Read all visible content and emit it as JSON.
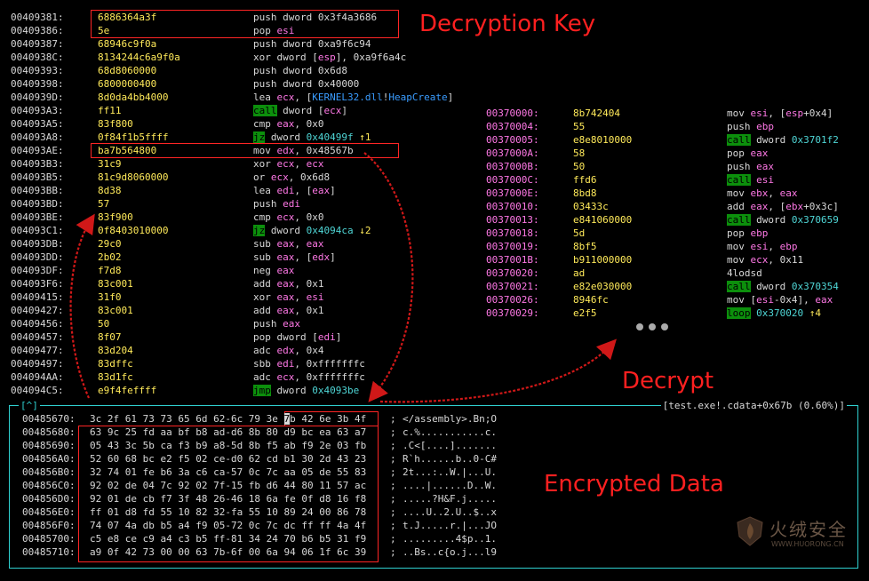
{
  "callouts": {
    "key": "Decryption Key",
    "decrypt": "Decrypt",
    "encrypted": "Encrypted Data"
  },
  "left_disasm": [
    {
      "addr": "00409381:",
      "bytes": "6886364a3f",
      "ins": "push dword 0x3f4a3686"
    },
    {
      "addr": "00409386:",
      "bytes": "5e",
      "ins": "pop esi"
    },
    {
      "addr": "00409387:",
      "bytes": "68946c9f0a",
      "ins": "push dword 0xa9f6c94"
    },
    {
      "addr": "0040938C:",
      "bytes": "8134244c6a9f0a",
      "ins": "xor dword [esp], 0xa9f6a4c"
    },
    {
      "addr": "00409393:",
      "bytes": "68d8060000",
      "ins": "push dword 0x6d8"
    },
    {
      "addr": "00409398:",
      "bytes": "6800000400",
      "ins": "push dword 0x40000"
    },
    {
      "addr": "0040939D:",
      "bytes": "8d0da4bb4000",
      "ins": "lea ecx, [KERNEL32.dll!HeapCreate]"
    },
    {
      "addr": "004093A3:",
      "bytes": "ff11",
      "ins": "call dword [ecx]"
    },
    {
      "addr": "004093A5:",
      "bytes": "83f800",
      "ins": "cmp eax, 0x0"
    },
    {
      "addr": "004093A8:",
      "bytes": "0f84f1b5ffff",
      "ins": "jz dword 0x40499f ↑1"
    },
    {
      "addr": "004093AE:",
      "bytes": "ba7b564800",
      "ins": "mov edx, 0x48567b"
    },
    {
      "addr": "004093B3:",
      "bytes": "31c9",
      "ins": "xor ecx, ecx"
    },
    {
      "addr": "004093B5:",
      "bytes": "81c9d8060000",
      "ins": "or ecx, 0x6d8"
    },
    {
      "addr": "004093BB:",
      "bytes": "8d38",
      "ins": "lea edi, [eax]"
    },
    {
      "addr": "004093BD:",
      "bytes": "57",
      "ins": "push edi"
    },
    {
      "addr": "004093BE:",
      "bytes": "83f900",
      "ins": "cmp ecx, 0x0"
    },
    {
      "addr": "004093C1:",
      "bytes": "0f8403010000",
      "ins": "jz dword 0x4094ca ↓2"
    },
    {
      "addr": "004093DB:",
      "bytes": "29c0",
      "ins": "sub eax, eax"
    },
    {
      "addr": "004093DD:",
      "bytes": "2b02",
      "ins": "sub eax, [edx]"
    },
    {
      "addr": "004093DF:",
      "bytes": "f7d8",
      "ins": "neg eax"
    },
    {
      "addr": "004093F6:",
      "bytes": "83c001",
      "ins": "add eax, 0x1"
    },
    {
      "addr": "00409415:",
      "bytes": "31f0",
      "ins": "xor eax, esi"
    },
    {
      "addr": "00409427:",
      "bytes": "83c001",
      "ins": "add eax, 0x1"
    },
    {
      "addr": "00409456:",
      "bytes": "50",
      "ins": "push eax"
    },
    {
      "addr": "00409457:",
      "bytes": "8f07",
      "ins": "pop dword [edi]"
    },
    {
      "addr": "00409477:",
      "bytes": "83d204",
      "ins": "adc edx, 0x4"
    },
    {
      "addr": "00409497:",
      "bytes": "83dffc",
      "ins": "sbb edi, 0xfffffffc"
    },
    {
      "addr": "004094AA:",
      "bytes": "83d1fc",
      "ins": "adc ecx, 0xfffffffc"
    },
    {
      "addr": "004094C5:",
      "bytes": "e9f4feffff",
      "ins": "jmp dword 0x4093be"
    }
  ],
  "right_disasm": [
    {
      "addr": "00370000:",
      "bytes": "8b742404",
      "ins": "mov esi, [esp+0x4]"
    },
    {
      "addr": "00370004:",
      "bytes": "55",
      "ins": "push ebp"
    },
    {
      "addr": "00370005:",
      "bytes": "e8e8010000",
      "ins": "call dword 0x3701f2"
    },
    {
      "addr": "0037000A:",
      "bytes": "58",
      "ins": "pop eax"
    },
    {
      "addr": "0037000B:",
      "bytes": "50",
      "ins": "push eax"
    },
    {
      "addr": "0037000C:",
      "bytes": "ffd6",
      "ins": "call esi"
    },
    {
      "addr": "0037000E:",
      "bytes": "8bd8",
      "ins": "mov ebx, eax"
    },
    {
      "addr": "00370010:",
      "bytes": "03433c",
      "ins": "add eax, [ebx+0x3c]"
    },
    {
      "addr": "00370013:",
      "bytes": "e841060000",
      "ins": "call dword 0x370659"
    },
    {
      "addr": "00370018:",
      "bytes": "5d",
      "ins": "pop ebp"
    },
    {
      "addr": "00370019:",
      "bytes": "8bf5",
      "ins": "mov esi, ebp"
    },
    {
      "addr": "0037001B:",
      "bytes": "b911000000",
      "ins": "mov ecx, 0x11"
    },
    {
      "addr": "00370020:",
      "bytes": "ad",
      "ins": "4lodsd"
    },
    {
      "addr": "00370021:",
      "bytes": "e82e030000",
      "ins": "call dword 0x370354"
    },
    {
      "addr": "00370026:",
      "bytes": "8946fc",
      "ins": "mov [esi-0x4], eax"
    },
    {
      "addr": "00370029:",
      "bytes": "e2f5",
      "ins": "loop 0x370020 ↑4"
    }
  ],
  "hex_panel": {
    "header_left": "[^]",
    "header_right": "[test.exe!.cdata+0x67b (0.60%)]",
    "rows": [
      {
        "addr": "00485670:",
        "bytes": "3c 2f 61 73 73 65 6d 62-6c 79 3e 7b 42 6e 3b 4f",
        "ascii": "</assembly>.Bn;O"
      },
      {
        "addr": "00485680:",
        "bytes": "63 9c 25 fd aa bf b8 ad-d6 8b 80 d9 bc ea 63 a7",
        "ascii": "c.%...........c."
      },
      {
        "addr": "00485690:",
        "bytes": "05 43 3c 5b ca f3 b9 a8-5d 8b f5 ab f9 2e 03 fb",
        "ascii": ".C<[....]......."
      },
      {
        "addr": "004856A0:",
        "bytes": "52 60 68 bc e2 f5 02 ce-d0 62 cd b1 30 2d 43 23",
        "ascii": "R`h......b..0-C#"
      },
      {
        "addr": "004856B0:",
        "bytes": "32 74 01 fe b6 3a c6 ca-57 0c 7c aa 05 de 55 83",
        "ascii": "2t...:..W.|...U."
      },
      {
        "addr": "004856C0:",
        "bytes": "92 02 de 04 7c 92 02 7f-15 fb d6 44 80 11 57 ac",
        "ascii": "....|......D..W."
      },
      {
        "addr": "004856D0:",
        "bytes": "92 01 de cb f7 3f 48 26-46 18 6a fe 0f d8 16 f8",
        "ascii": ".....?H&F.j....."
      },
      {
        "addr": "004856E0:",
        "bytes": "ff 01 d8 fd 55 10 82 32-fa 55 10 89 24 00 86 78",
        "ascii": "....U..2.U..$..x"
      },
      {
        "addr": "004856F0:",
        "bytes": "74 07 4a db b5 a4 f9 05-72 0c 7c dc ff ff 4a 4f",
        "ascii": "t.J.....r.|...JO"
      },
      {
        "addr": "00485700:",
        "bytes": "c5 e8 ce c9 a4 c3 b5 ff-81 34 24 70 b6 b5 31 f9",
        "ascii": ".........4$p..1."
      },
      {
        "addr": "00485710:",
        "bytes": "a9 0f 42 73 00 00 63 7b-6f 00 6a 94 06 1f 6c 39",
        "ascii": "..Bs..c{o.j...l9"
      }
    ],
    "separator": ";"
  },
  "watermark": {
    "text": "火绒安全",
    "url": "WWW.HUORONG.CN"
  },
  "colors": {
    "address": "#d8d8d8",
    "bytes": "#ffea5a",
    "register": "#ff78e6",
    "symbol": "#3a9cff",
    "literal": "#4fd6d6",
    "branch_bg": "#0c8f0c",
    "annotation": "#ff2020",
    "panel_border": "#2fd0d0"
  }
}
